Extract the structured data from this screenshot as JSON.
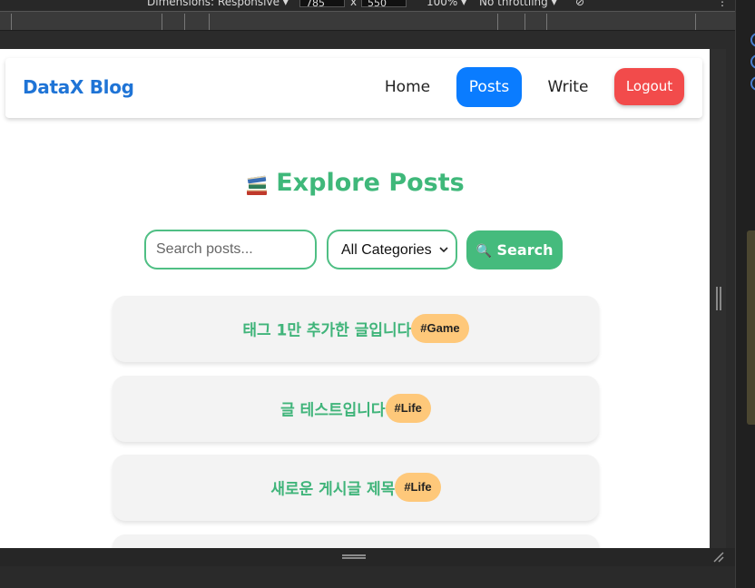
{
  "devtools": {
    "dimensions_label": "Dimensions: Responsive",
    "width": "785",
    "times": "x",
    "height": "550",
    "zoom": "100%",
    "throttling": "No throttling"
  },
  "navbar": {
    "brand": "DataX Blog",
    "links": [
      {
        "label": "Home"
      },
      {
        "label": "Posts"
      },
      {
        "label": "Write"
      }
    ],
    "logout_label": "Logout",
    "active_color": "#0a7cff",
    "logout_color": "#f24b4b"
  },
  "page": {
    "title": "Explore Posts",
    "title_icon": "books-icon"
  },
  "search": {
    "placeholder": "Search posts...",
    "category_selected": "All Categories",
    "button_label": "Search",
    "button_icon": "magnifier-icon"
  },
  "posts": [
    {
      "title": "태그 1만 추가한 글입니다",
      "tag": "#Game"
    },
    {
      "title": "글 테스트입니다",
      "tag": "#Life"
    },
    {
      "title": "새로운 게시글 제목",
      "tag": "#Life"
    }
  ],
  "colors": {
    "accent_green": "#3fb87a",
    "tag_bg": "#fec87a",
    "brand_blue": "#1f74d6"
  }
}
